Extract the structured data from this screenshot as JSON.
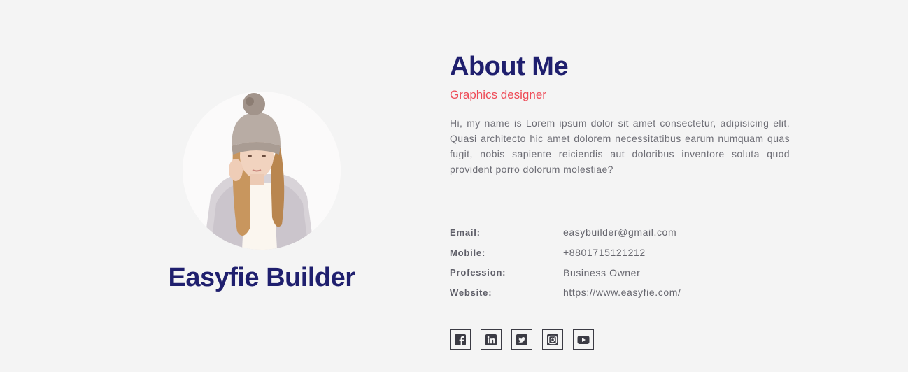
{
  "profile": {
    "name": "Easyfie Builder"
  },
  "about": {
    "title": "About Me",
    "role": "Graphics designer",
    "bio": "Hi, my name is Lorem ipsum dolor sit amet consectetur, adipisicing elit. Quasi architecto hic amet dolorem necessitatibus earum numquam quas fugit, nobis sapiente reiciendis aut doloribus inventore soluta quod provident porro dolorum molestiae?"
  },
  "info": [
    {
      "label": "Email:",
      "value": "easybuilder@gmail.com"
    },
    {
      "label": "Mobile:",
      "value": "+8801715121212"
    },
    {
      "label": "Profession:",
      "value": "Business Owner"
    },
    {
      "label": "Website:",
      "value": "https://www.easyfie.com/"
    }
  ],
  "social": [
    {
      "icon": "facebook-icon"
    },
    {
      "icon": "linkedin-icon"
    },
    {
      "icon": "twitter-icon"
    },
    {
      "icon": "instagram-icon"
    },
    {
      "icon": "youtube-icon"
    }
  ],
  "colors": {
    "background": "#f4f4f4",
    "heading": "#1f1f6e",
    "accent": "#ee4b57",
    "text": "#6d6d75"
  }
}
